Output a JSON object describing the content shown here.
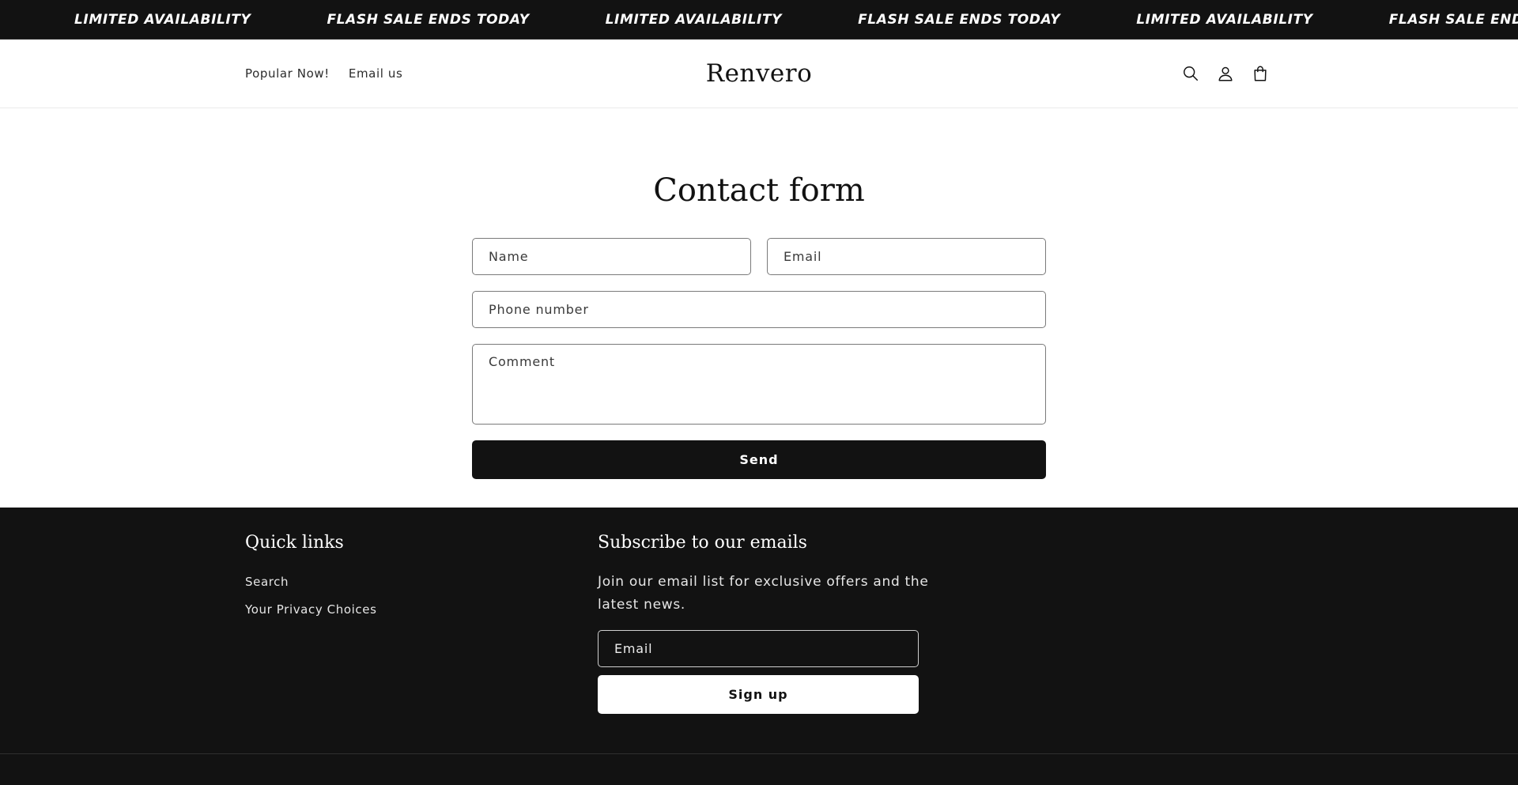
{
  "announcement": {
    "items": [
      "LIMITED AVAILABILITY",
      "FLASH SALE ENDS TODAY",
      "LIMITED AVAILABILITY",
      "FLASH SALE ENDS TODAY",
      "LIMITED AVAILABILITY",
      "FLASH SALE ENDS TODAY"
    ]
  },
  "header": {
    "nav": [
      "Popular Now!",
      "Email us"
    ],
    "logo": "Renvero",
    "icons": [
      "search-icon",
      "account-icon",
      "cart-icon"
    ]
  },
  "contact": {
    "title": "Contact form",
    "name_placeholder": "Name",
    "email_placeholder": "Email",
    "phone_placeholder": "Phone number",
    "comment_placeholder": "Comment",
    "send_label": "Send"
  },
  "footer": {
    "quick_links_heading": "Quick links",
    "quick_links": [
      "Search",
      "Your Privacy Choices"
    ],
    "subscribe_heading": "Subscribe to our emails",
    "subscribe_text": "Join our email list for exclusive offers and the latest news.",
    "email_placeholder": "Email",
    "signup_label": "Sign up"
  },
  "colors": {
    "dark": "#121212",
    "light": "#ffffff",
    "border": "#7a7a7a"
  }
}
